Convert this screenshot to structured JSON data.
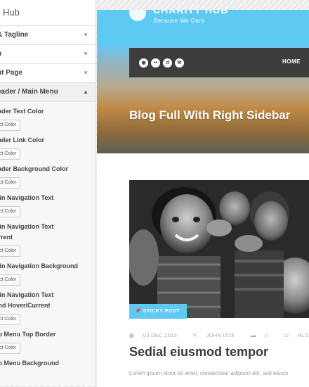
{
  "customizer": {
    "title": "Hub",
    "sections": [
      {
        "label": "& Tagline",
        "caret": "▼"
      },
      {
        "label": "n",
        "caret": "▼"
      },
      {
        "label": "nt Page",
        "caret": "▼"
      },
      {
        "label": "eader / Main Menu",
        "caret": "▲"
      }
    ],
    "controls": [
      {
        "label": "eader Text Color",
        "label2": "",
        "button": "ct Color"
      },
      {
        "label": "eader Link Color",
        "label2": "",
        "button": "ct Color"
      },
      {
        "label": "eader Background Color",
        "label2": "",
        "button": "ct Color"
      },
      {
        "label": "lain Navigation Text",
        "label2": "",
        "button": "ct Color"
      },
      {
        "label": "lain Navigation Text",
        "label2": "urrent",
        "button": "ct Color"
      },
      {
        "label": "lain Navigation Background",
        "label2": "",
        "button": "ct Color"
      },
      {
        "label": "lain Navigation Text",
        "label2": "und Hover/Current",
        "button": "ct Color"
      },
      {
        "label": "ub Menu Top Border",
        "label2": "",
        "button": "ct Color"
      },
      {
        "label": "ub Menu Background",
        "label2": "",
        "button": ""
      }
    ]
  },
  "site": {
    "brand": "CHARITY HUB",
    "tagline": "Because We Care",
    "social_icons": [
      "dribbble-icon",
      "flickr-icon",
      "digg-icon",
      "email-icon"
    ],
    "nav_home": "HOME",
    "page_heading": "Blog Full With Right Sidebar",
    "sticky_label": "STICKY POST",
    "meta": {
      "date": "03 DEC 2013",
      "author": "JOHN DOE",
      "comments": "0",
      "categories": "BLOG, FIT ROW, LIFE S"
    },
    "post_title": "Sedial eiusmod tempor",
    "excerpt": "Lorem ipsum dolor sit amet, consectetur adipisici elit, sed eiusm"
  },
  "colors": {
    "accent": "#5ec9f3",
    "navbar": "#3d3d3d"
  }
}
